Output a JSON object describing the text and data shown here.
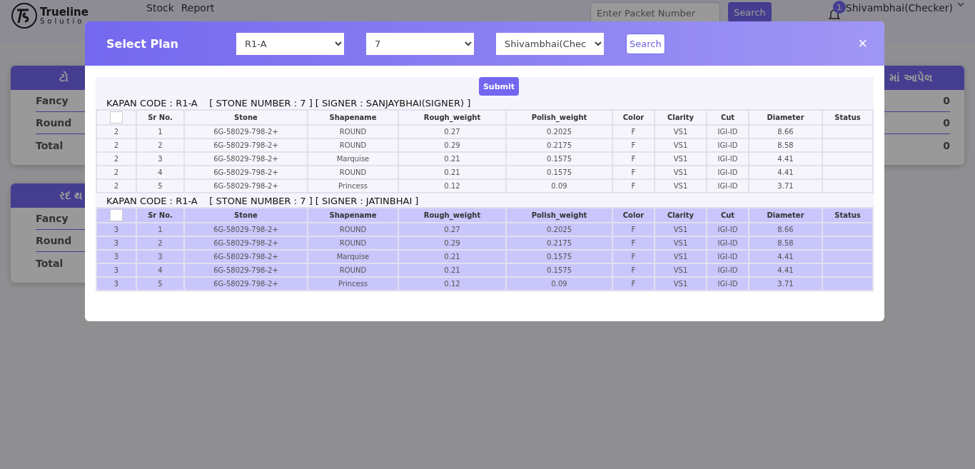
{
  "header": {
    "logo_name": "Trueline",
    "logo_sub": "Solutio",
    "nav": [
      "Stock",
      "Report"
    ],
    "search": {
      "placeholder": "Enter Packet Number",
      "button": "Search"
    },
    "notifications": "1",
    "user": "Shivambhai(Checker)"
  },
  "cards_left": [
    {
      "title": "ટો",
      "rows": [
        "Fancy",
        "Round",
        "Total"
      ]
    },
    {
      "title": "રદ થ",
      "rows": [
        "Fancy",
        "Round",
        "Total"
      ]
    }
  ],
  "card_right": {
    "title": "માં આપેલ",
    "values": [
      "0",
      "0",
      "0"
    ]
  },
  "modal": {
    "title": "Select Plan",
    "filters": [
      "R1-A",
      "7",
      "Shivambhai(Chec"
    ],
    "search": "Search",
    "close": "×",
    "submit": "Submit",
    "plans": [
      {
        "title": "KAPAN CODE : R1-A    [ STONE NUMBER : 7 ] [ SIGNER : SANJAYBHAI(SIGNER) ]",
        "selected": false,
        "checked": false,
        "columns": [
          "",
          "Sr No.",
          "Stone",
          "Shapename",
          "Rough_weight",
          "Polish_weight",
          "Color",
          "Clarity",
          "Cut",
          "Diameter",
          "Status"
        ],
        "rows": [
          [
            "2",
            "1",
            "6G-58029-798-2+",
            "ROUND",
            "0.27",
            "0.2025",
            "F",
            "VS1",
            "IGI-ID",
            "8.66"
          ],
          [
            "2",
            "2",
            "6G-58029-798-2+",
            "ROUND",
            "0.29",
            "0.2175",
            "F",
            "VS1",
            "IGI-ID",
            "8.58"
          ],
          [
            "2",
            "3",
            "6G-58029-798-2+",
            "Marquise",
            "0.21",
            "0.1575",
            "F",
            "VS1",
            "IGI-ID",
            "4.41"
          ],
          [
            "2",
            "4",
            "6G-58029-798-2+",
            "ROUND",
            "0.21",
            "0.1575",
            "F",
            "VS1",
            "IGI-ID",
            "4.41"
          ],
          [
            "2",
            "5",
            "6G-58029-798-2+",
            "Princess",
            "0.12",
            "0.09",
            "F",
            "VS1",
            "IGI-ID",
            "3.71"
          ]
        ]
      },
      {
        "title": "KAPAN CODE : R1-A    [ STONE NUMBER : 7 ] [ SIGNER : JATINBHAI ]",
        "selected": true,
        "checked": false,
        "columns": [
          "",
          "Sr No.",
          "Stone",
          "Shapename",
          "Rough_weight",
          "Polish_weight",
          "Color",
          "Clarity",
          "Cut",
          "Diameter",
          "Status"
        ],
        "rows": [
          [
            "3",
            "1",
            "6G-58029-798-2+",
            "ROUND",
            "0.27",
            "0.2025",
            "F",
            "VS1",
            "IGI-ID",
            "8.66"
          ],
          [
            "3",
            "2",
            "6G-58029-798-2+",
            "ROUND",
            "0.29",
            "0.2175",
            "F",
            "VS1",
            "IGI-ID",
            "8.58"
          ],
          [
            "3",
            "3",
            "6G-58029-798-2+",
            "Marquise",
            "0.21",
            "0.1575",
            "F",
            "VS1",
            "IGI-ID",
            "4.41"
          ],
          [
            "3",
            "4",
            "6G-58029-798-2+",
            "ROUND",
            "0.21",
            "0.1575",
            "F",
            "VS1",
            "IGI-ID",
            "4.41"
          ],
          [
            "3",
            "5",
            "6G-58029-798-2+",
            "Princess",
            "0.12",
            "0.09",
            "F",
            "VS1",
            "IGI-ID",
            "3.71"
          ]
        ]
      }
    ]
  }
}
